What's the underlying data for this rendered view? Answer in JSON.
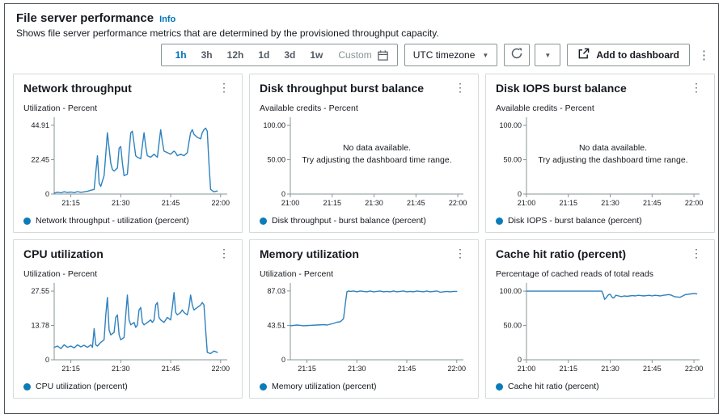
{
  "page": {
    "title": "File server performance",
    "info_label": "Info",
    "subtitle": "Shows file server performance metrics that are determined by the provisioned throughput capacity."
  },
  "icons": {
    "kebab": "⋮",
    "caret_down": "▼"
  },
  "toolbar": {
    "ranges": [
      "1h",
      "3h",
      "12h",
      "1d",
      "3d",
      "1w"
    ],
    "selected_range": "1h",
    "custom_label": "Custom",
    "timezone_label": "UTC timezone",
    "add_to_dashboard_label": "Add to dashboard"
  },
  "colors": {
    "accent": "#0073bb",
    "line": "#2e81bd",
    "legend_dot": "#0c7bba",
    "axis": "#879596"
  },
  "panels": [
    {
      "title": "Network throughput",
      "ylabel": "Utilization - Percent",
      "legend": "Network throughput - utilization (percent)"
    },
    {
      "title": "Disk throughput burst balance",
      "ylabel": "Available credits - Percent",
      "legend": "Disk throughput - burst balance (percent)"
    },
    {
      "title": "Disk IOPS burst balance",
      "ylabel": "Available credits - Percent",
      "legend": "Disk IOPS - burst balance (percent)"
    },
    {
      "title": "CPU utilization",
      "ylabel": "Utilization - Percent",
      "legend": "CPU utilization (percent)"
    },
    {
      "title": "Memory utilization",
      "ylabel": "Utilization - Percent",
      "legend": "Memory utilization (percent)"
    },
    {
      "title": "Cache hit ratio (percent)",
      "ylabel": "Percentage of cached reads of total reads",
      "legend": "Cache hit ratio (percent)"
    }
  ],
  "chart_data": [
    {
      "type": "line",
      "title": "Network throughput",
      "ylabel": "Utilization - Percent",
      "color": "#2e81bd",
      "xlim": [
        10,
        62
      ],
      "ylim": [
        0,
        47.5
      ],
      "yticks": [
        {
          "v": 0,
          "label": "0"
        },
        {
          "v": 22.45,
          "label": "22.45"
        },
        {
          "v": 44.91,
          "label": "44.91"
        }
      ],
      "xticks": [
        {
          "v": 15,
          "label": "21:15"
        },
        {
          "v": 30,
          "label": "21:30"
        },
        {
          "v": 45,
          "label": "21:45"
        },
        {
          "v": 60,
          "label": "22:00"
        }
      ],
      "series": [
        [
          10,
          0.6
        ],
        [
          11,
          1.2
        ],
        [
          12,
          0.8
        ],
        [
          13,
          1.5
        ],
        [
          14,
          1.0
        ],
        [
          15,
          1.3
        ],
        [
          16,
          0.9
        ],
        [
          17,
          1.6
        ],
        [
          18,
          1.1
        ],
        [
          19,
          1.4
        ],
        [
          20,
          1.8
        ],
        [
          21,
          2.5
        ],
        [
          22,
          3.0
        ],
        [
          22.5,
          14
        ],
        [
          23,
          25
        ],
        [
          23.5,
          7
        ],
        [
          24,
          5
        ],
        [
          25,
          12
        ],
        [
          25.5,
          26
        ],
        [
          26,
          40
        ],
        [
          26.5,
          30
        ],
        [
          27,
          20
        ],
        [
          27.5,
          16
        ],
        [
          28,
          15
        ],
        [
          29,
          17
        ],
        [
          29.5,
          30
        ],
        [
          30,
          31
        ],
        [
          30.5,
          20
        ],
        [
          31,
          12
        ],
        [
          32,
          13
        ],
        [
          32.5,
          27
        ],
        [
          33,
          40
        ],
        [
          33.5,
          41
        ],
        [
          34,
          33
        ],
        [
          34.5,
          25
        ],
        [
          35,
          24
        ],
        [
          36,
          23
        ],
        [
          36.5,
          32
        ],
        [
          37,
          40
        ],
        [
          37.5,
          31
        ],
        [
          38,
          25
        ],
        [
          39,
          24
        ],
        [
          40,
          26
        ],
        [
          40.5,
          25
        ],
        [
          41,
          24
        ],
        [
          41.5,
          33
        ],
        [
          42,
          42
        ],
        [
          42.5,
          34
        ],
        [
          43,
          28
        ],
        [
          44,
          27
        ],
        [
          45,
          26
        ],
        [
          46,
          28
        ],
        [
          46.5,
          27
        ],
        [
          47,
          25
        ],
        [
          48,
          26
        ],
        [
          49,
          25
        ],
        [
          50,
          27
        ],
        [
          50.5,
          34
        ],
        [
          51,
          40
        ],
        [
          51.5,
          42
        ],
        [
          52,
          39
        ],
        [
          53,
          37
        ],
        [
          54,
          36
        ],
        [
          54.5,
          40
        ],
        [
          55,
          42
        ],
        [
          55.5,
          43
        ],
        [
          56,
          41
        ],
        [
          56.5,
          20
        ],
        [
          57,
          3
        ],
        [
          58,
          1.5
        ],
        [
          59,
          2
        ]
      ]
    },
    {
      "type": "line",
      "title": "Disk throughput burst balance",
      "ylabel": "Available credits - Percent",
      "color": "#2e81bd",
      "xlim": [
        0,
        62
      ],
      "ylim": [
        0,
        106
      ],
      "yticks": [
        {
          "v": 0,
          "label": "0"
        },
        {
          "v": 50,
          "label": "50.00"
        },
        {
          "v": 100,
          "label": "100.00"
        }
      ],
      "xticks": [
        {
          "v": 0,
          "label": "21:00"
        },
        {
          "v": 15,
          "label": "21:15"
        },
        {
          "v": 30,
          "label": "21:30"
        },
        {
          "v": 45,
          "label": "21:45"
        },
        {
          "v": 60,
          "label": "22:00"
        }
      ],
      "series": [],
      "no_data": [
        "No data available.",
        "Try adjusting the dashboard time range."
      ]
    },
    {
      "type": "line",
      "title": "Disk IOPS burst balance",
      "ylabel": "Available credits - Percent",
      "color": "#2e81bd",
      "xlim": [
        0,
        62
      ],
      "ylim": [
        0,
        106
      ],
      "yticks": [
        {
          "v": 0,
          "label": "0"
        },
        {
          "v": 50,
          "label": "50.00"
        },
        {
          "v": 100,
          "label": "100.00"
        }
      ],
      "xticks": [
        {
          "v": 0,
          "label": "21:00"
        },
        {
          "v": 15,
          "label": "21:15"
        },
        {
          "v": 30,
          "label": "21:30"
        },
        {
          "v": 45,
          "label": "21:45"
        },
        {
          "v": 60,
          "label": "22:00"
        }
      ],
      "series": [],
      "no_data": [
        "No data available.",
        "Try adjusting the dashboard time range."
      ]
    },
    {
      "type": "line",
      "title": "CPU utilization",
      "ylabel": "Utilization - Percent",
      "color": "#2e81bd",
      "xlim": [
        10,
        62
      ],
      "ylim": [
        0,
        29.2
      ],
      "yticks": [
        {
          "v": 0,
          "label": "0"
        },
        {
          "v": 13.78,
          "label": "13.78"
        },
        {
          "v": 27.55,
          "label": "27.55"
        }
      ],
      "xticks": [
        {
          "v": 15,
          "label": "21:15"
        },
        {
          "v": 30,
          "label": "21:30"
        },
        {
          "v": 45,
          "label": "21:45"
        },
        {
          "v": 60,
          "label": "22:00"
        }
      ],
      "series": [
        [
          10,
          5
        ],
        [
          11,
          5.5
        ],
        [
          12,
          4.5
        ],
        [
          13,
          6
        ],
        [
          14,
          5
        ],
        [
          15,
          5.5
        ],
        [
          16,
          4.8
        ],
        [
          17,
          6
        ],
        [
          18,
          5.2
        ],
        [
          19,
          5.8
        ],
        [
          20,
          5
        ],
        [
          21,
          6
        ],
        [
          21.5,
          5
        ],
        [
          22,
          12.5
        ],
        [
          22.5,
          6
        ],
        [
          23,
          5.5
        ],
        [
          24,
          7
        ],
        [
          25,
          8
        ],
        [
          25.5,
          18
        ],
        [
          26,
          25
        ],
        [
          26.5,
          12
        ],
        [
          27,
          10
        ],
        [
          28,
          11
        ],
        [
          28.5,
          17
        ],
        [
          29,
          18
        ],
        [
          29.5,
          10
        ],
        [
          30,
          8
        ],
        [
          31,
          9
        ],
        [
          31.5,
          18
        ],
        [
          32,
          26
        ],
        [
          32.5,
          16
        ],
        [
          33,
          14
        ],
        [
          34,
          15
        ],
        [
          34.5,
          13
        ],
        [
          35,
          14
        ],
        [
          35.5,
          20
        ],
        [
          36,
          21
        ],
        [
          36.5,
          15
        ],
        [
          37,
          14
        ],
        [
          38,
          15
        ],
        [
          39,
          16
        ],
        [
          39.5,
          15
        ],
        [
          40,
          16
        ],
        [
          40.5,
          22
        ],
        [
          41,
          23
        ],
        [
          41.5,
          17
        ],
        [
          42,
          16
        ],
        [
          43,
          15
        ],
        [
          44,
          17
        ],
        [
          45,
          16
        ],
        [
          45.5,
          21
        ],
        [
          46,
          27
        ],
        [
          46.5,
          19
        ],
        [
          47,
          18
        ],
        [
          48,
          19
        ],
        [
          48.5,
          20
        ],
        [
          49,
          19
        ],
        [
          50,
          18
        ],
        [
          50.5,
          21
        ],
        [
          51,
          26
        ],
        [
          51.5,
          22
        ],
        [
          52,
          20
        ],
        [
          53,
          21
        ],
        [
          54,
          22
        ],
        [
          54.5,
          23
        ],
        [
          55,
          22
        ],
        [
          55.5,
          12
        ],
        [
          56,
          3
        ],
        [
          57,
          2.5
        ],
        [
          58,
          3.5
        ],
        [
          59,
          3
        ]
      ]
    },
    {
      "type": "line",
      "title": "Memory utilization",
      "ylabel": "Utilization - Percent",
      "color": "#2e81bd",
      "xlim": [
        10,
        62
      ],
      "ylim": [
        0,
        92
      ],
      "yticks": [
        {
          "v": 0,
          "label": "0"
        },
        {
          "v": 43.51,
          "label": "43.51"
        },
        {
          "v": 87.03,
          "label": "87.03"
        }
      ],
      "xticks": [
        {
          "v": 15,
          "label": "21:15"
        },
        {
          "v": 30,
          "label": "21:30"
        },
        {
          "v": 45,
          "label": "21:45"
        },
        {
          "v": 60,
          "label": "22:00"
        }
      ],
      "series": [
        [
          10,
          43
        ],
        [
          12,
          44
        ],
        [
          13,
          43.5
        ],
        [
          14,
          43
        ],
        [
          16,
          43.5
        ],
        [
          18,
          44
        ],
        [
          20,
          44.5
        ],
        [
          21,
          44
        ],
        [
          22,
          45
        ],
        [
          23,
          46
        ],
        [
          24,
          47.5
        ],
        [
          25,
          48
        ],
        [
          25.5,
          50
        ],
        [
          26,
          52
        ],
        [
          26.5,
          70
        ],
        [
          27,
          86
        ],
        [
          27.5,
          87
        ],
        [
          28,
          86.5
        ],
        [
          29,
          87
        ],
        [
          30,
          86
        ],
        [
          31,
          87
        ],
        [
          32,
          86.5
        ],
        [
          33,
          86
        ],
        [
          34,
          87
        ],
        [
          35,
          86
        ],
        [
          36,
          86.5
        ],
        [
          37,
          87
        ],
        [
          38,
          86
        ],
        [
          39,
          86.5
        ],
        [
          40,
          86
        ],
        [
          41,
          87
        ],
        [
          42,
          86
        ],
        [
          43,
          86.5
        ],
        [
          44,
          87
        ],
        [
          45,
          86
        ],
        [
          46,
          86.5
        ],
        [
          47,
          86
        ],
        [
          48,
          87
        ],
        [
          49,
          86.5
        ],
        [
          50,
          86
        ],
        [
          51,
          87
        ],
        [
          52,
          86
        ],
        [
          53,
          86.5
        ],
        [
          54,
          87
        ],
        [
          55,
          85.5
        ],
        [
          56,
          86
        ],
        [
          57,
          86.5
        ],
        [
          58,
          86
        ],
        [
          59,
          86.5
        ],
        [
          60,
          86.5
        ]
      ]
    },
    {
      "type": "line",
      "title": "Cache hit ratio (percent)",
      "ylabel": "Percentage of cached reads of total reads",
      "color": "#2e81bd",
      "xlim": [
        0,
        62
      ],
      "ylim": [
        0,
        106
      ],
      "yticks": [
        {
          "v": 0,
          "label": "0"
        },
        {
          "v": 50,
          "label": "50.00"
        },
        {
          "v": 100,
          "label": "100.00"
        }
      ],
      "xticks": [
        {
          "v": 0,
          "label": "21:00"
        },
        {
          "v": 15,
          "label": "21:15"
        },
        {
          "v": 30,
          "label": "21:30"
        },
        {
          "v": 45,
          "label": "21:45"
        },
        {
          "v": 60,
          "label": "22:00"
        }
      ],
      "series": [
        [
          0,
          100
        ],
        [
          2,
          100
        ],
        [
          4,
          100
        ],
        [
          6,
          100
        ],
        [
          8,
          100
        ],
        [
          10,
          100
        ],
        [
          12,
          100
        ],
        [
          14,
          100
        ],
        [
          16,
          100
        ],
        [
          18,
          100
        ],
        [
          20,
          100
        ],
        [
          22,
          100
        ],
        [
          24,
          100
        ],
        [
          26,
          100
        ],
        [
          27,
          100
        ],
        [
          27.5,
          95
        ],
        [
          28,
          88
        ],
        [
          28.5,
          90
        ],
        [
          29,
          93
        ],
        [
          29.5,
          95
        ],
        [
          30,
          95.5
        ],
        [
          30.5,
          92
        ],
        [
          31,
          90
        ],
        [
          31.5,
          91
        ],
        [
          32,
          94
        ],
        [
          33,
          93
        ],
        [
          34,
          92
        ],
        [
          35,
          93
        ],
        [
          36,
          92.5
        ],
        [
          37,
          93
        ],
        [
          38,
          93.5
        ],
        [
          39,
          93
        ],
        [
          40,
          94
        ],
        [
          41,
          93.5
        ],
        [
          42,
          93
        ],
        [
          43,
          93.5
        ],
        [
          44,
          94
        ],
        [
          45,
          93
        ],
        [
          46,
          94
        ],
        [
          47,
          93.5
        ],
        [
          48,
          93
        ],
        [
          49,
          94
        ],
        [
          50,
          94.5
        ],
        [
          51,
          95
        ],
        [
          52,
          94
        ],
        [
          53,
          92
        ],
        [
          54,
          91.5
        ],
        [
          55,
          91
        ],
        [
          56,
          93
        ],
        [
          57,
          95
        ],
        [
          58,
          95.5
        ],
        [
          59,
          96
        ],
        [
          60,
          96.5
        ],
        [
          61,
          96
        ]
      ]
    }
  ]
}
